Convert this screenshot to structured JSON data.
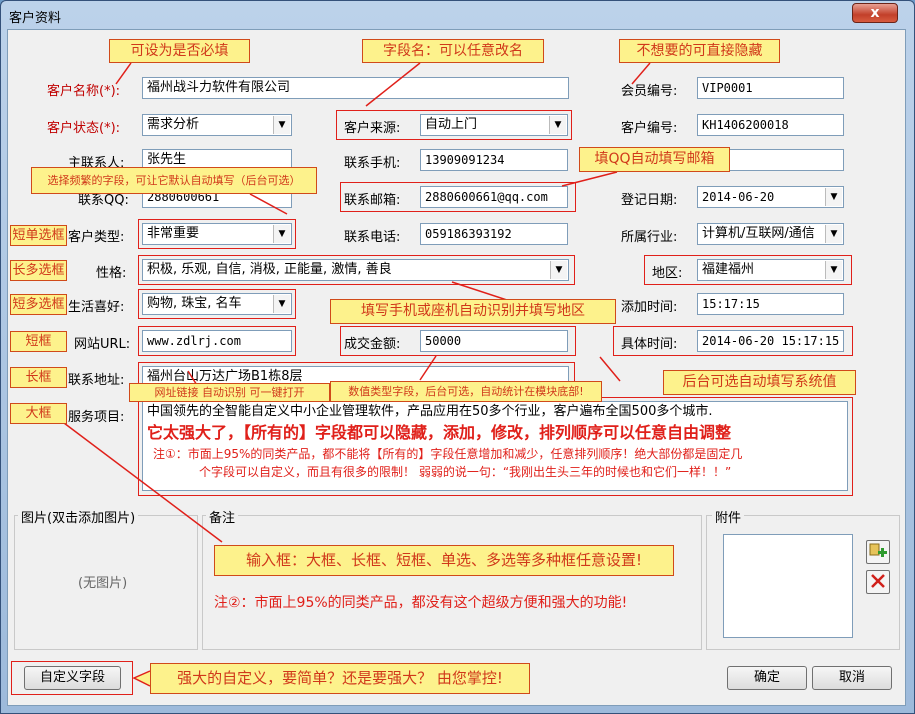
{
  "window": {
    "title": "客户资料",
    "close_glyph": "x"
  },
  "fields": {
    "customer_name": {
      "label": "客户名称(*):",
      "value": "福州战斗力软件有限公司"
    },
    "customer_status": {
      "label": "客户状态(*):",
      "value": "需求分析"
    },
    "primary_contact": {
      "label": "主联系人:",
      "value": "张先生"
    },
    "contact_qq": {
      "label": "联系QQ:",
      "value": "2880600661"
    },
    "customer_type": {
      "label": "客户类型:",
      "value": "非常重要"
    },
    "personality": {
      "label": "性格:",
      "value": "积极, 乐观, 自信, 消极, 正能量, 激情, 善良"
    },
    "hobbies": {
      "label": "生活喜好:",
      "value": "购物, 珠宝, 名车"
    },
    "website": {
      "label": "网站URL:",
      "value": "www.zdlrj.com"
    },
    "address": {
      "label": "联系地址:",
      "value": "福州台山万达广场B1栋8层"
    },
    "service": {
      "label": "服务项目:"
    },
    "source": {
      "label": "客户来源:",
      "value": "自动上门"
    },
    "mobile": {
      "label": "联系手机:",
      "value": "13909091234"
    },
    "email": {
      "label": "联系邮箱:",
      "value": "2880600661@qq.com"
    },
    "phone": {
      "label": "联系电话:",
      "value": "059186393192"
    },
    "deal_amount": {
      "label": "成交金额:",
      "value": "50000"
    },
    "member_no": {
      "label": "会员编号:",
      "value": "VIP0001"
    },
    "customer_no": {
      "label": "客户编号:",
      "value": "KH1406200018"
    },
    "register_date": {
      "label": "登记日期:",
      "value": "2014-06-20"
    },
    "industry": {
      "label": "所属行业:",
      "value": "计算机/互联网/通信"
    },
    "region": {
      "label": "地区:",
      "value": "福建福州"
    },
    "add_time": {
      "label": "添加时间:",
      "value": "15:17:15"
    },
    "exact_time": {
      "label": "具体时间:",
      "value": "2014-06-20 15:17:15"
    }
  },
  "service_text": {
    "line1": "中国领先的全智能自定义中小企业管理软件，产品应用在50多个行业，客户遍布全国500多个城市.",
    "line2": "它太强大了，【所有的】字段都可以隐藏，添加，修改，排列顺序可以任意自由调整",
    "note1a": "注①：市面上95%的同类产品，都不能将【所有的】字段任意增加和减少，任意排列顺序！绝大部份都是固定几",
    "note1b": "个字段可以自定义，而且有很多的限制！   弱弱的说一句：“我刚出生头三年的时候也和它们一样！！”"
  },
  "groups": {
    "image": {
      "legend": "图片(双击添加图片)",
      "empty": "(无图片)"
    },
    "remark": {
      "legend": "备注"
    },
    "attachment": {
      "legend": "附件"
    }
  },
  "buttons": {
    "custom_fields": "自定义字段",
    "ok": "确定",
    "cancel": "取消"
  },
  "annotations": {
    "optional_required": "可设为是否必填",
    "rename_field": "字段名：可以任意改名",
    "hide_unwanted": "不想要的可直接隐藏",
    "frequent_select": "选择频繁的字段，可让它默认自动填写（后台可选）",
    "qq_fill_email": "填QQ自动填写邮箱",
    "short_single": "短单选框",
    "long_multi": "长多选框",
    "short_multi": "短多选框",
    "short_box": "短框",
    "long_box": "长框",
    "big_box": "大框",
    "phone_region": "填写手机或座机自动识别并填写地区",
    "url_link": "网址链接 自动识别 可一键打开",
    "numeric_field": "数值类型字段，后台可选，自动统计在模块底部!",
    "system_value": "后台可选自动填写系统值",
    "input_types": "输入框：大框、长框、短框、单选、多选等多种框任意设置!",
    "note2": "注②：市面上95%的同类产品，都没有这个超级方便和强大的功能!",
    "custom_power": "强大的自定义，要简单？还是要强大？ 由您掌控!"
  },
  "icons": {
    "dropdown": "▼",
    "add_attachment": "add-attachment-icon",
    "delete_attachment": "delete-icon"
  }
}
